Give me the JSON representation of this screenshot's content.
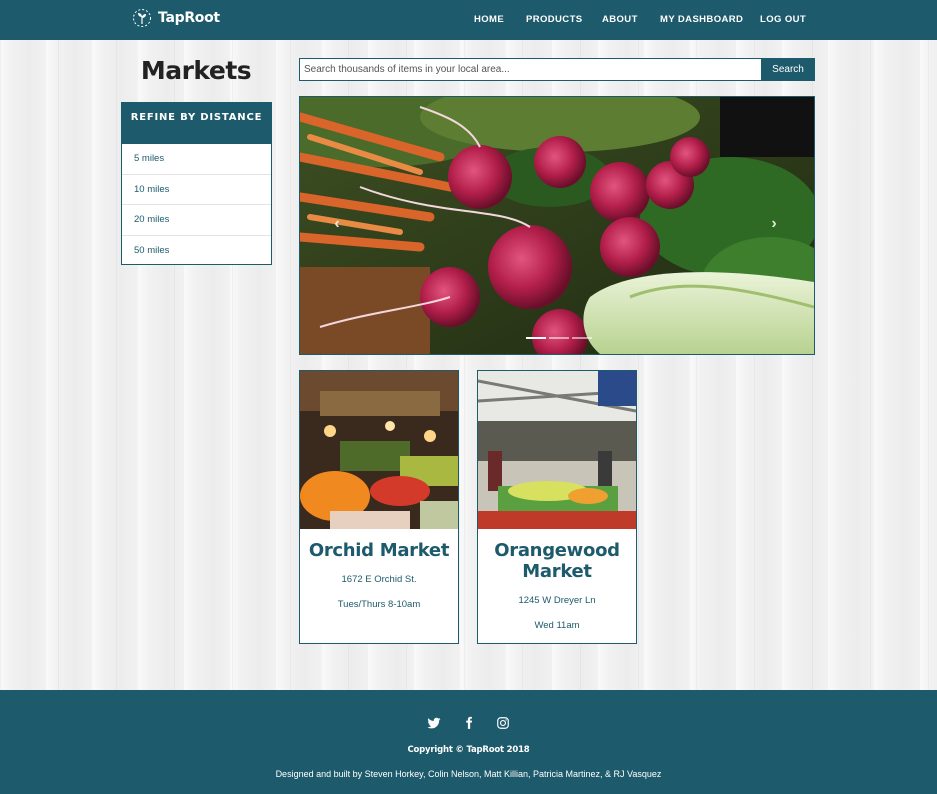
{
  "brand": {
    "name": "TapRoot",
    "icon": "sprout-logo-icon"
  },
  "nav": {
    "home": "HOME",
    "products": "PRODUCTS",
    "about": "ABOUT",
    "dashboard": "MY DASHBOARD",
    "logout": "LOG OUT"
  },
  "page": {
    "title": "Markets"
  },
  "refine": {
    "heading": "REFINE BY DISTANCE",
    "options": [
      "5 miles",
      "10 miles",
      "20 miles",
      "50 miles"
    ]
  },
  "search": {
    "placeholder": "Search thousands of items in your local area...",
    "value": "",
    "button": "Search"
  },
  "carousel": {
    "slide_count": 3,
    "active_index": 0,
    "prev_icon": "chevron-left-icon",
    "next_icon": "chevron-right-icon"
  },
  "markets": [
    {
      "name": "Orchid Market",
      "address": "1672 E Orchid St.",
      "hours": "Tues/Thurs 8-10am"
    },
    {
      "name": "Orangewood Market",
      "address": "1245 W Dreyer Ln",
      "hours": "Wed 11am"
    }
  ],
  "footer": {
    "social": [
      "twitter-icon",
      "facebook-icon",
      "instagram-icon"
    ],
    "copyright": "Copyright © TapRoot 2018",
    "credits": "Designed and built by Steven Horkey, Colin Nelson, Matt Killian, Patricia Martinez, & RJ Vasquez"
  },
  "colors": {
    "primary": "#1d5a6b",
    "text_dark": "#222222",
    "background": "#f1f1f1"
  }
}
